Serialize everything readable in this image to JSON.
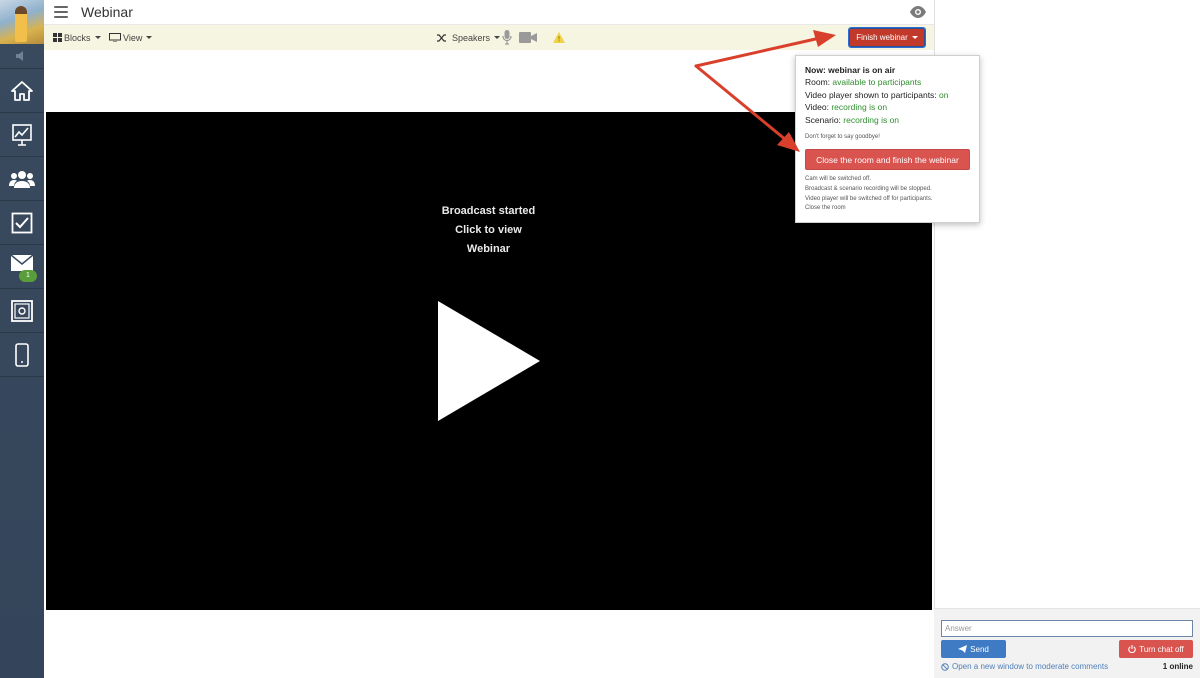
{
  "header": {
    "title": "Webinar"
  },
  "toolbar": {
    "blocks_label": "Blocks",
    "view_label": "View",
    "speakers_label": "Speakers",
    "finish_label": "Finish webinar"
  },
  "video": {
    "line1": "Broadcast started",
    "line2": "Click to view",
    "line3": "Webinar"
  },
  "sidebar": {
    "mail_badge": "1",
    "items": [
      "home-icon",
      "chart-icon",
      "users-icon",
      "checkbox-icon",
      "mail-icon",
      "safe-icon",
      "phone-icon"
    ]
  },
  "popover": {
    "heading": "Now: webinar is on air",
    "room_label": "Room: ",
    "room_value": "available to participants",
    "player_label": "Video player shown to participants: ",
    "player_value": "on",
    "video_label": "Video: ",
    "video_value": "recording is on",
    "scenario_label": "Scenario: ",
    "scenario_value": "recording is on",
    "goodbye": "Don't forget to say goodbye!",
    "close_button": "Close the room and finish the webinar",
    "notes": [
      "Cam will be switched off.",
      "Broadcast & scenario recording will be stopped.",
      "Video player will be switched off for participants.",
      "Close the room"
    ]
  },
  "chat": {
    "answer_placeholder": "Answer",
    "send_label": "Send",
    "turn_off_label": "Turn chat off",
    "moderate_link": "Open a new window to moderate comments",
    "online_count": "1 online"
  },
  "colors": {
    "sidebar": "#3a4a5e",
    "toolbar_bg": "#f6f5e1",
    "finish_button": "#c0392b",
    "close_room_button": "#d9534f",
    "send_button": "#3f7bc4",
    "status_green": "#2f8f2f",
    "annotation_arrow": "#d9402b"
  }
}
